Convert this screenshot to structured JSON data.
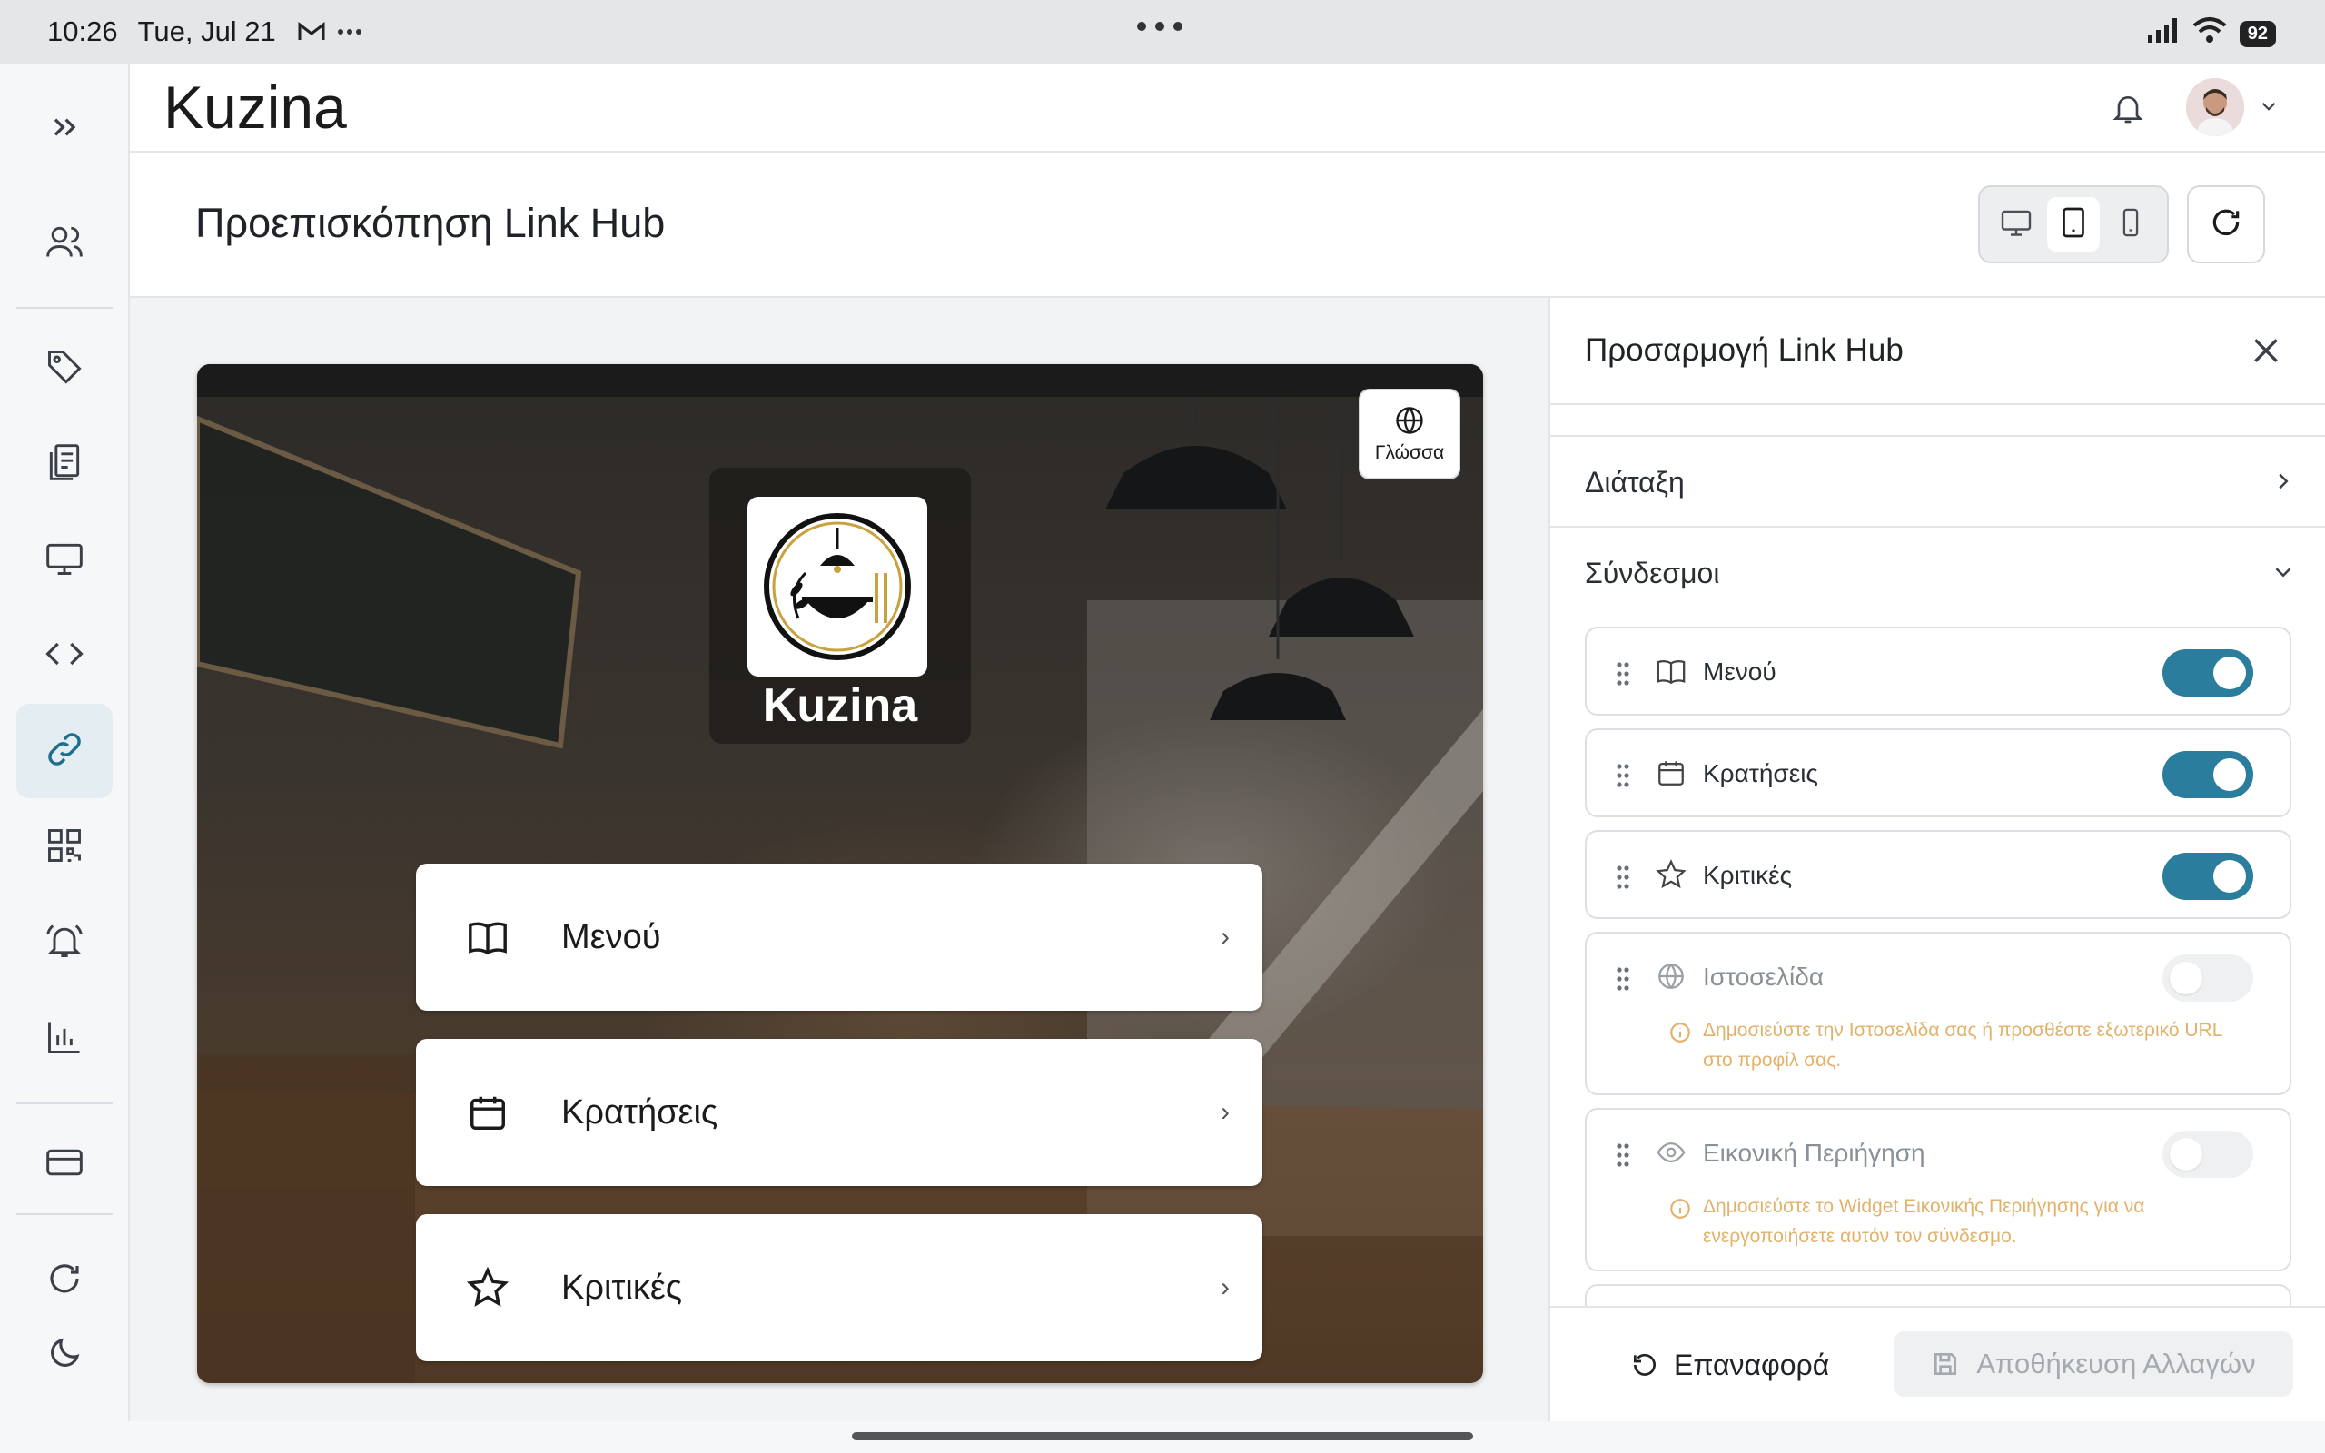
{
  "status_bar": {
    "time": "10:26",
    "date": "Tue, Jul 21",
    "battery": "92"
  },
  "header": {
    "app_title": "Kuzina"
  },
  "sidebar": {
    "items": [
      {
        "icon": "expand-icon",
        "label": ""
      },
      {
        "icon": "users-icon",
        "label": ""
      },
      {
        "icon": "tag-icon",
        "label": ""
      },
      {
        "icon": "document-icon",
        "label": ""
      },
      {
        "icon": "monitor-icon",
        "label": ""
      },
      {
        "icon": "code-icon",
        "label": ""
      },
      {
        "icon": "link-icon",
        "label": "",
        "active": true
      },
      {
        "icon": "qr-code-icon",
        "label": ""
      },
      {
        "icon": "alarm-bell-icon",
        "label": ""
      },
      {
        "icon": "bar-chart-icon",
        "label": ""
      },
      {
        "icon": "credit-card-icon",
        "label": ""
      },
      {
        "icon": "refresh-icon",
        "label": ""
      },
      {
        "icon": "moon-icon",
        "label": ""
      }
    ]
  },
  "subheader": {
    "title": "Προεπισκόπηση Link Hub"
  },
  "preview": {
    "language_label": "Γλώσσα",
    "brand_name": "Kuzina",
    "links": [
      {
        "label": "Μενού",
        "icon": "book-icon"
      },
      {
        "label": "Κρατήσεις",
        "icon": "calendar-icon"
      },
      {
        "label": "Κριτικές",
        "icon": "star-icon"
      }
    ]
  },
  "panel": {
    "title": "Προσαρμογή Link Hub",
    "layout_label": "Διάταξη",
    "links_label": "Σύνδεσμοι",
    "link_items": [
      {
        "label": "Μενού",
        "icon": "book-icon",
        "enabled": true
      },
      {
        "label": "Κρατήσεις",
        "icon": "calendar-icon",
        "enabled": true
      },
      {
        "label": "Κριτικές",
        "icon": "star-icon",
        "enabled": true
      },
      {
        "label": "Ιστοσελίδα",
        "icon": "globe-icon",
        "enabled": false,
        "hint": "Δημοσιεύστε την Ιστοσελίδα σας ή προσθέστε εξωτερικό URL στο προφίλ σας."
      },
      {
        "label": "Εικονική Περιήγηση",
        "icon": "eye-icon",
        "enabled": false,
        "hint": "Δημοσιεύστε το Widget Εικονικής Περιήγησης για να ενεργοποιήσετε αυτόν τον σύνδεσμο."
      }
    ],
    "reset_label": "Επαναφορά",
    "save_label": "Αποθήκευση Αλλαγών"
  },
  "colors": {
    "accent": "#2a7d9c",
    "hint": "#e3b26a",
    "active_nav_bg": "#e3edf2"
  }
}
